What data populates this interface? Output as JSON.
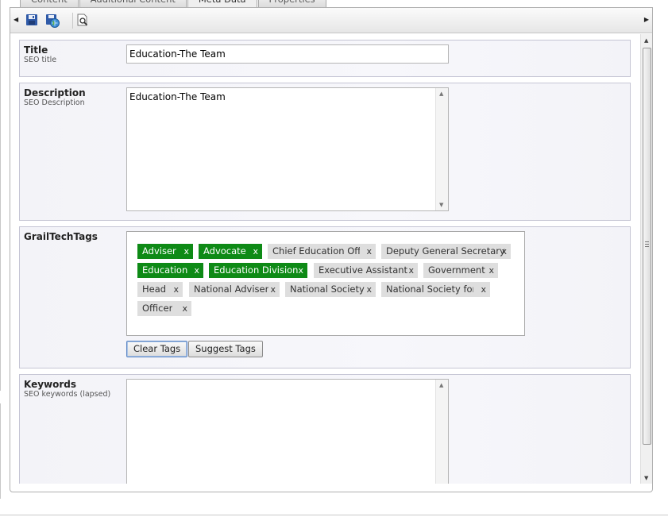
{
  "tabs": [
    {
      "label": "Content"
    },
    {
      "label": "Additional Content"
    },
    {
      "label": "Meta Data",
      "active": true
    },
    {
      "label": "Properties"
    }
  ],
  "toolbar": {
    "buttons": [
      {
        "name": "save-icon"
      },
      {
        "name": "save-publish-icon"
      },
      {
        "name": "preview-icon"
      }
    ]
  },
  "title_field": {
    "label": "Title",
    "sublabel": "SEO title",
    "value": "Education-The Team"
  },
  "description_field": {
    "label": "Description",
    "sublabel": "SEO Description",
    "value": "Education-The Team"
  },
  "tags_field": {
    "label": "GrailTechTags",
    "tags": [
      {
        "label": "Adviser",
        "selected": true
      },
      {
        "label": "Advocate",
        "selected": true
      },
      {
        "label": "Chief Education Officer",
        "selected": false
      },
      {
        "label": "Deputy General Secretary",
        "selected": false
      },
      {
        "label": "Education",
        "selected": true
      },
      {
        "label": "Education Division",
        "selected": true
      },
      {
        "label": "Executive Assistant",
        "selected": false
      },
      {
        "label": "Government",
        "selected": false
      },
      {
        "label": "Head",
        "selected": false
      },
      {
        "label": "National Adviser",
        "selected": false
      },
      {
        "label": "National Society",
        "selected": false
      },
      {
        "label": "National Society for the",
        "selected": false
      },
      {
        "label": "Officer",
        "selected": false
      }
    ],
    "remove_glyph": "x",
    "clear_label": "Clear Tags",
    "suggest_label": "Suggest Tags"
  },
  "keywords_field": {
    "label": "Keywords",
    "sublabel": "SEO keywords (lapsed)",
    "value": ""
  },
  "colors": {
    "tag_selected": "#0e8a16",
    "tag_unselected": "#dedede",
    "section_border": "#c5c5d4"
  }
}
